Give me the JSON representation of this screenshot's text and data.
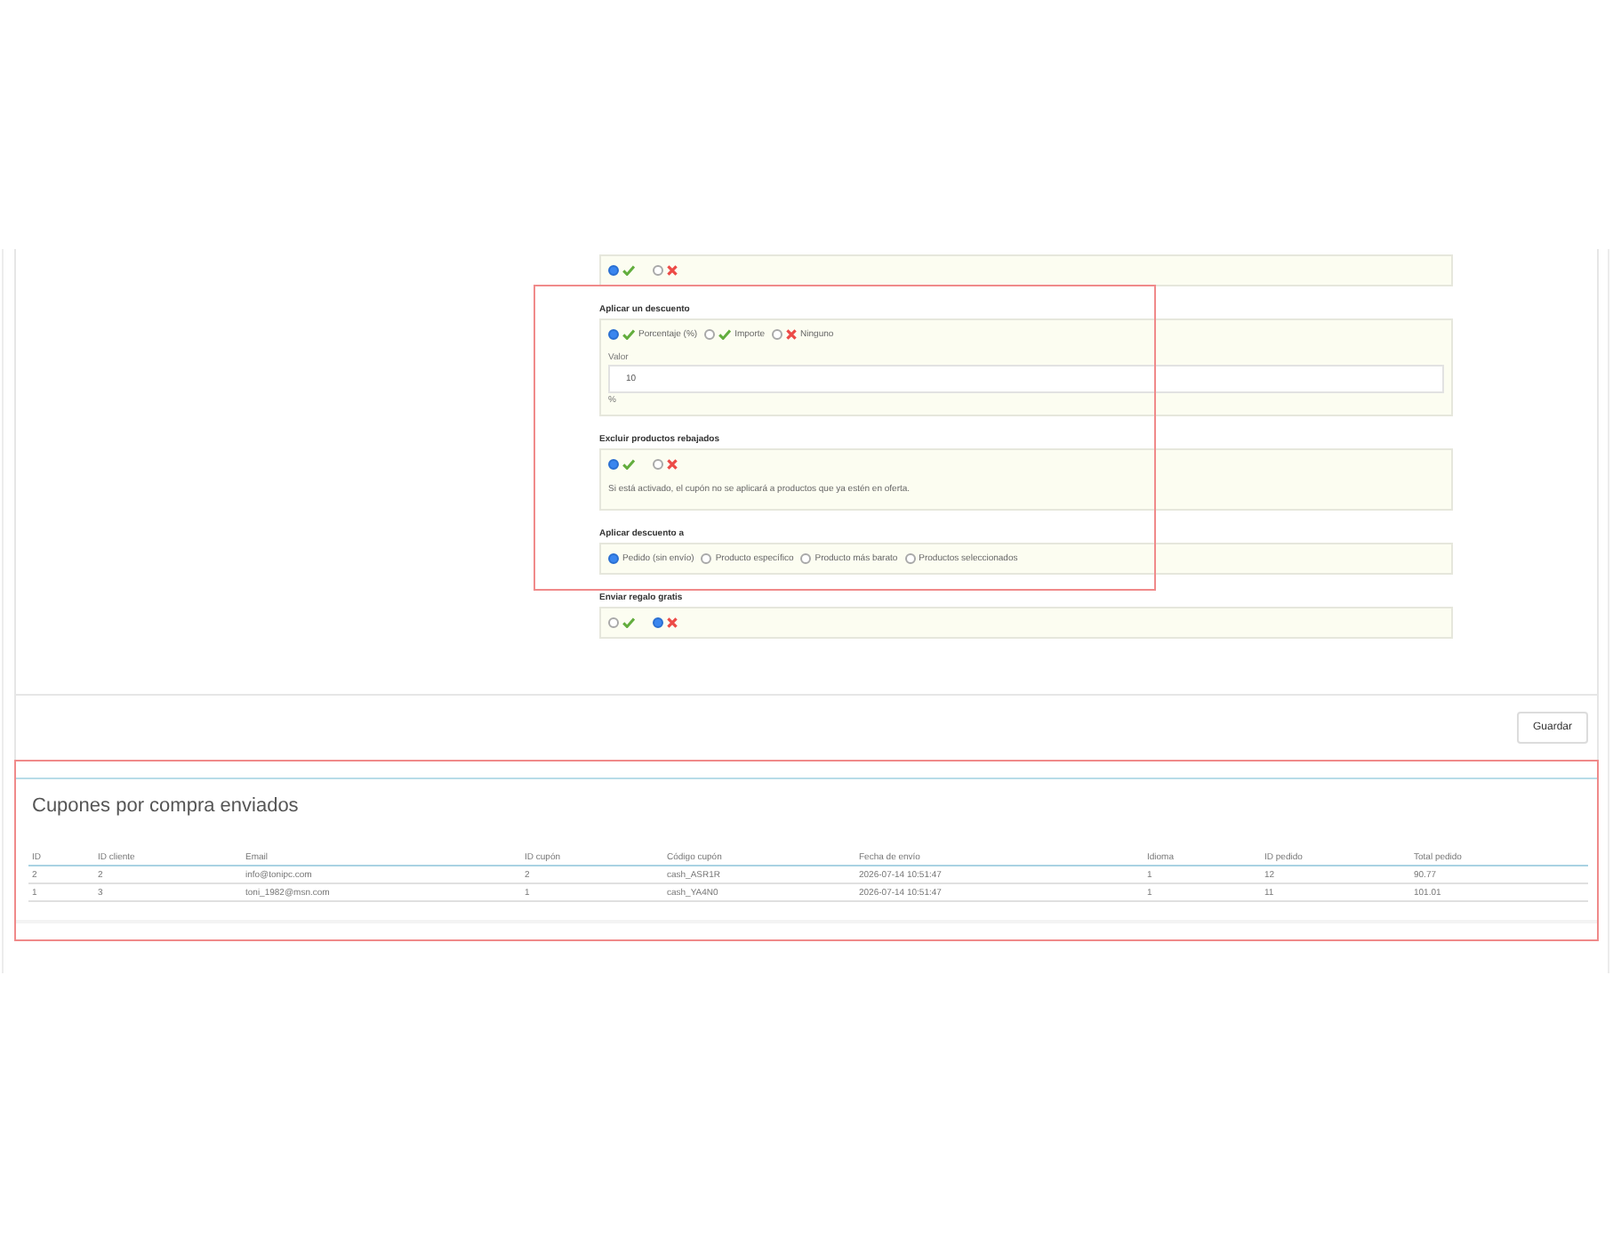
{
  "form": {
    "sections": [
      {
        "highlighted": false,
        "options": [
          {
            "kind": "check",
            "selected": true
          },
          {
            "kind": "cross",
            "selected": false
          }
        ]
      },
      {
        "label": "Aplicar un descuento",
        "highlighted": true,
        "options": [
          {
            "kind": "check",
            "text": "Porcentaje (%)",
            "selected": true
          },
          {
            "kind": "check",
            "text": "Importe",
            "selected": false
          },
          {
            "kind": "cross",
            "text": "Ninguno",
            "selected": false
          }
        ],
        "field": {
          "label": "Valor",
          "value": "10",
          "suffix": "%"
        }
      },
      {
        "label": "Excluir productos rebajados",
        "highlighted": true,
        "options": [
          {
            "kind": "check",
            "selected": true
          },
          {
            "kind": "cross",
            "selected": false
          }
        ],
        "help": "Si está activado, el cupón no se aplicará a productos que ya estén en oferta."
      },
      {
        "label": "Aplicar descuento a",
        "highlighted": true,
        "options": [
          {
            "kind": "plain",
            "text": "Pedido (sin envío)",
            "selected": true
          },
          {
            "kind": "plain",
            "text": "Producto específico",
            "selected": false
          },
          {
            "kind": "plain",
            "text": "Producto más barato",
            "selected": false
          },
          {
            "kind": "plain",
            "text": "Productos seleccionados",
            "selected": false
          }
        ]
      },
      {
        "label": "Enviar regalo gratis",
        "highlighted": false,
        "options": [
          {
            "kind": "check",
            "selected": false
          },
          {
            "kind": "cross",
            "selected": true
          }
        ]
      }
    ]
  },
  "save_button": "Guardar",
  "coupons_panel": {
    "title": "Cupones por compra enviados",
    "highlighted": true,
    "table": {
      "columns": [
        "ID",
        "ID cliente",
        "Email",
        "ID cupón",
        "Código cupón",
        "Fecha de envío",
        "Idioma",
        "ID pedido",
        "Total pedido"
      ],
      "rows": [
        [
          "2",
          "2",
          "info@tonipc.com",
          "2",
          "cash_ASR1R",
          "2026-07-14 10:51:47",
          "1",
          "12",
          "90.77"
        ],
        [
          "1",
          "3",
          "toni_1982@msn.com",
          "1",
          "cash_YA4N0",
          "2026-07-14 10:51:47",
          "1",
          "11",
          "101.01"
        ]
      ]
    }
  }
}
